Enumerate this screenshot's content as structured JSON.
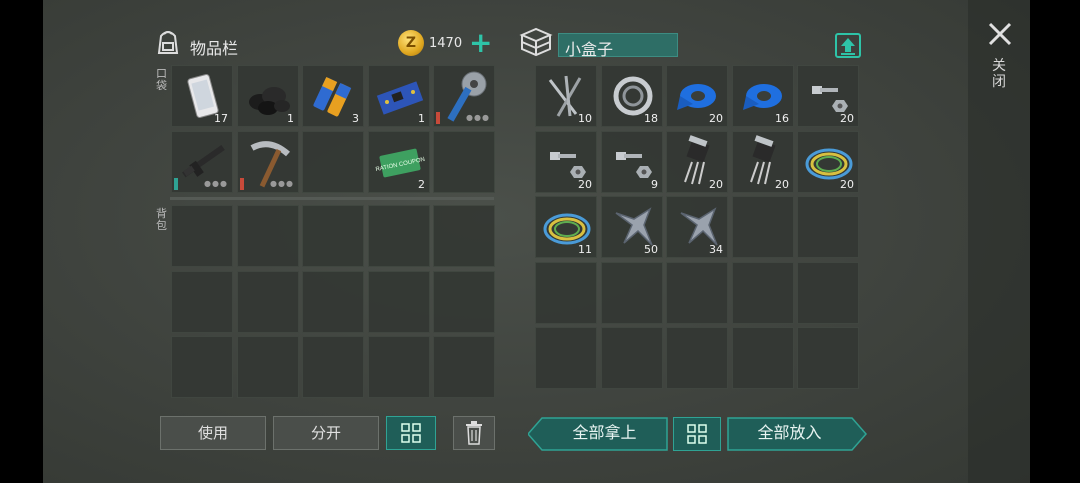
{
  "inventory": {
    "title": "物品栏",
    "pocket_label": "口袋",
    "backpack_label": "背包",
    "coin_symbol": "Z",
    "coins": "1470",
    "add_symbol": "+",
    "pocket_slots": [
      {
        "icon": "phone-icon",
        "qty": "17"
      },
      {
        "icon": "coal-icon",
        "qty": "1"
      },
      {
        "icon": "battery-icon",
        "qty": "3"
      },
      {
        "icon": "circuit-board-icon",
        "qty": "1"
      },
      {
        "icon": "buzzsaw-weapon-icon",
        "qty": "",
        "durability_color": "#c84a3a"
      },
      {
        "icon": "assault-rifle-icon",
        "qty": "",
        "durability_color": "#2fa394"
      },
      {
        "icon": "pickaxe-icon",
        "qty": "",
        "durability_color": "#c84a3a"
      },
      {
        "icon": "",
        "qty": ""
      },
      {
        "icon": "ration-coupon-icon",
        "qty": "2",
        "coupon_text": "RATION COUPON"
      },
      {
        "icon": "",
        "qty": ""
      }
    ]
  },
  "container": {
    "name": "小盒子",
    "slots": [
      {
        "icon": "nails-icon",
        "qty": "10"
      },
      {
        "icon": "bearing-icon",
        "qty": "18"
      },
      {
        "icon": "tape-icon",
        "qty": "20"
      },
      {
        "icon": "tape-icon",
        "qty": "16"
      },
      {
        "icon": "bolt-nut-icon",
        "qty": "20"
      },
      {
        "icon": "bolt-nut-icon",
        "qty": "20"
      },
      {
        "icon": "bolt-nut-icon",
        "qty": "9"
      },
      {
        "icon": "transistor-icon",
        "qty": "20"
      },
      {
        "icon": "transistor-icon",
        "qty": "20"
      },
      {
        "icon": "wire-coil-icon",
        "qty": "20"
      },
      {
        "icon": "wire-coil-icon",
        "qty": "11"
      },
      {
        "icon": "metal-scrap-icon",
        "qty": "50"
      },
      {
        "icon": "metal-scrap-icon",
        "qty": "34"
      }
    ]
  },
  "buttons": {
    "use": "使用",
    "split": "分开",
    "take_all": "全部拿上",
    "put_all": "全部放入"
  },
  "close_label": "关闭",
  "colors": {
    "accent": "#2ec4a8",
    "coin": "#e0a820"
  }
}
